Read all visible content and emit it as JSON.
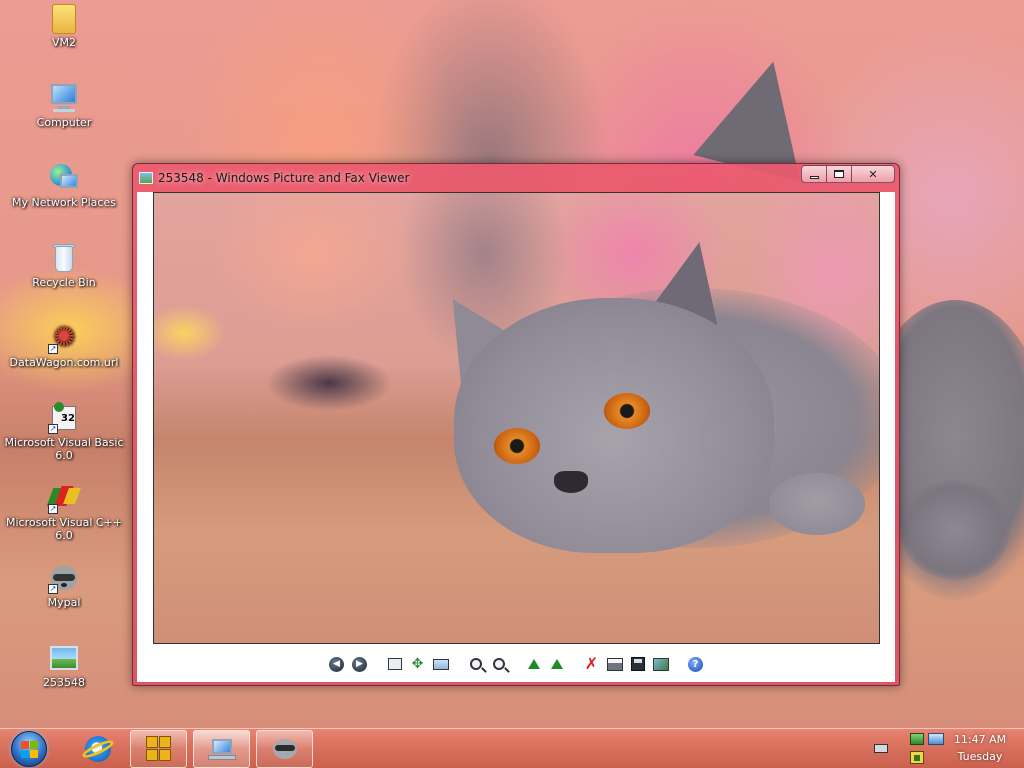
{
  "desktop": {
    "icons": [
      {
        "label": "VM2",
        "icon": "folder-icon"
      },
      {
        "label": "Computer",
        "icon": "computer-icon"
      },
      {
        "label": "My Network Places",
        "icon": "network-places-icon"
      },
      {
        "label": "Recycle Bin",
        "icon": "recycle-bin-icon"
      },
      {
        "label": "DataWagon.com.url",
        "icon": "web-shortcut-icon"
      },
      {
        "label": "Microsoft Visual Basic 6.0",
        "icon": "visual-basic-icon"
      },
      {
        "label": "Microsoft Visual C++ 6.0",
        "icon": "visual-cpp-icon"
      },
      {
        "label": "Mypal",
        "icon": "raccoon-icon"
      },
      {
        "label": "253548",
        "icon": "picture-file-icon"
      }
    ]
  },
  "window": {
    "title": "253548 - Windows Picture and Fax Viewer",
    "controls": {
      "minimize": "minimize",
      "maximize": "maximize",
      "close": "close"
    },
    "toolbar": [
      "previous-image",
      "next-image",
      "best-fit",
      "actual-size",
      "slide-show",
      "zoom-in",
      "zoom-out",
      "rotate-clockwise",
      "rotate-counterclockwise",
      "delete",
      "print",
      "copy-to",
      "close-and-edit",
      "help"
    ]
  },
  "taskbar": {
    "pinned": [
      "internet-explorer"
    ],
    "tasks": [
      "vmware",
      "picture-viewer",
      "mypal"
    ],
    "clock": {
      "time": "11:47 AM",
      "day": "Tuesday"
    }
  },
  "colors": {
    "window_frame": "#e05a6e",
    "taskbar": "#d66955"
  }
}
